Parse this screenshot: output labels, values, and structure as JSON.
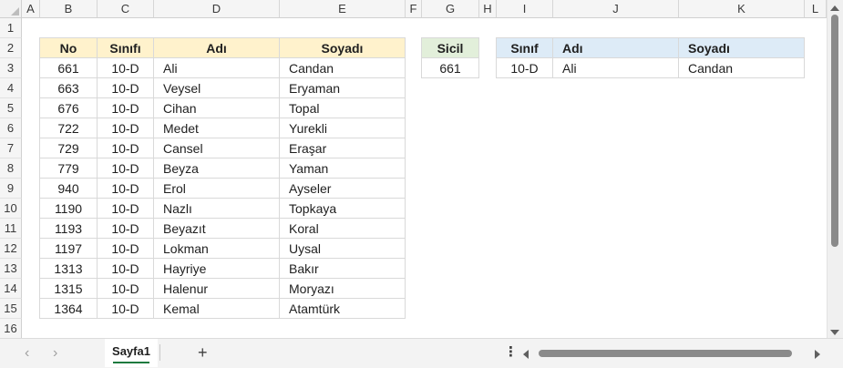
{
  "columns": [
    "A",
    "B",
    "C",
    "D",
    "E",
    "F",
    "G",
    "H",
    "I",
    "J",
    "K",
    "L"
  ],
  "rows": [
    "1",
    "2",
    "3",
    "4",
    "5",
    "6",
    "7",
    "8",
    "9",
    "10",
    "11",
    "12",
    "13",
    "14",
    "15",
    "16"
  ],
  "main_table": {
    "header_color": "#fff2cc",
    "header": {
      "no": "No",
      "sinifi": "Sınıfı",
      "adi": "Adı",
      "soyadi": "Soyadı"
    },
    "rows": [
      {
        "no": "661",
        "sinifi": "10-D",
        "adi": "Ali",
        "soyadi": "Candan"
      },
      {
        "no": "663",
        "sinifi": "10-D",
        "adi": "Veysel",
        "soyadi": "Eryaman"
      },
      {
        "no": "676",
        "sinifi": "10-D",
        "adi": "Cihan",
        "soyadi": "Topal"
      },
      {
        "no": "722",
        "sinifi": "10-D",
        "adi": "Medet",
        "soyadi": "Yurekli"
      },
      {
        "no": "729",
        "sinifi": "10-D",
        "adi": "Cansel",
        "soyadi": "Eraşar"
      },
      {
        "no": "779",
        "sinifi": "10-D",
        "adi": "Beyza",
        "soyadi": "Yaman"
      },
      {
        "no": "940",
        "sinifi": "10-D",
        "adi": "Erol",
        "soyadi": "Ayseler"
      },
      {
        "no": "1190",
        "sinifi": "10-D",
        "adi": "Nazlı",
        "soyadi": "Topkaya"
      },
      {
        "no": "1193",
        "sinifi": "10-D",
        "adi": "Beyazıt",
        "soyadi": "Koral"
      },
      {
        "no": "1197",
        "sinifi": "10-D",
        "adi": "Lokman",
        "soyadi": "Uysal"
      },
      {
        "no": "1313",
        "sinifi": "10-D",
        "adi": "Hayriye",
        "soyadi": "Bakır"
      },
      {
        "no": "1315",
        "sinifi": "10-D",
        "adi": "Halenur",
        "soyadi": "Moryazı"
      },
      {
        "no": "1364",
        "sinifi": "10-D",
        "adi": "Kemal",
        "soyadi": "Atamtürk"
      }
    ]
  },
  "sicil_box": {
    "header_color": "#e2efda",
    "label": "Sicil",
    "value": "661"
  },
  "result_table": {
    "header_color": "#ddebf7",
    "header": {
      "sinif": "Sınıf",
      "adi": "Adı",
      "soyadi": "Soyadı"
    },
    "row": {
      "sinif": "10-D",
      "adi": "Ali",
      "soyadi": "Candan"
    }
  },
  "bottom_bar": {
    "nav_prev_icon": "chevron-left-icon",
    "nav_next_icon": "chevron-right-icon",
    "sheet_tab": "Sayfa1",
    "add_sheet": "+",
    "more_options": "⋮"
  }
}
